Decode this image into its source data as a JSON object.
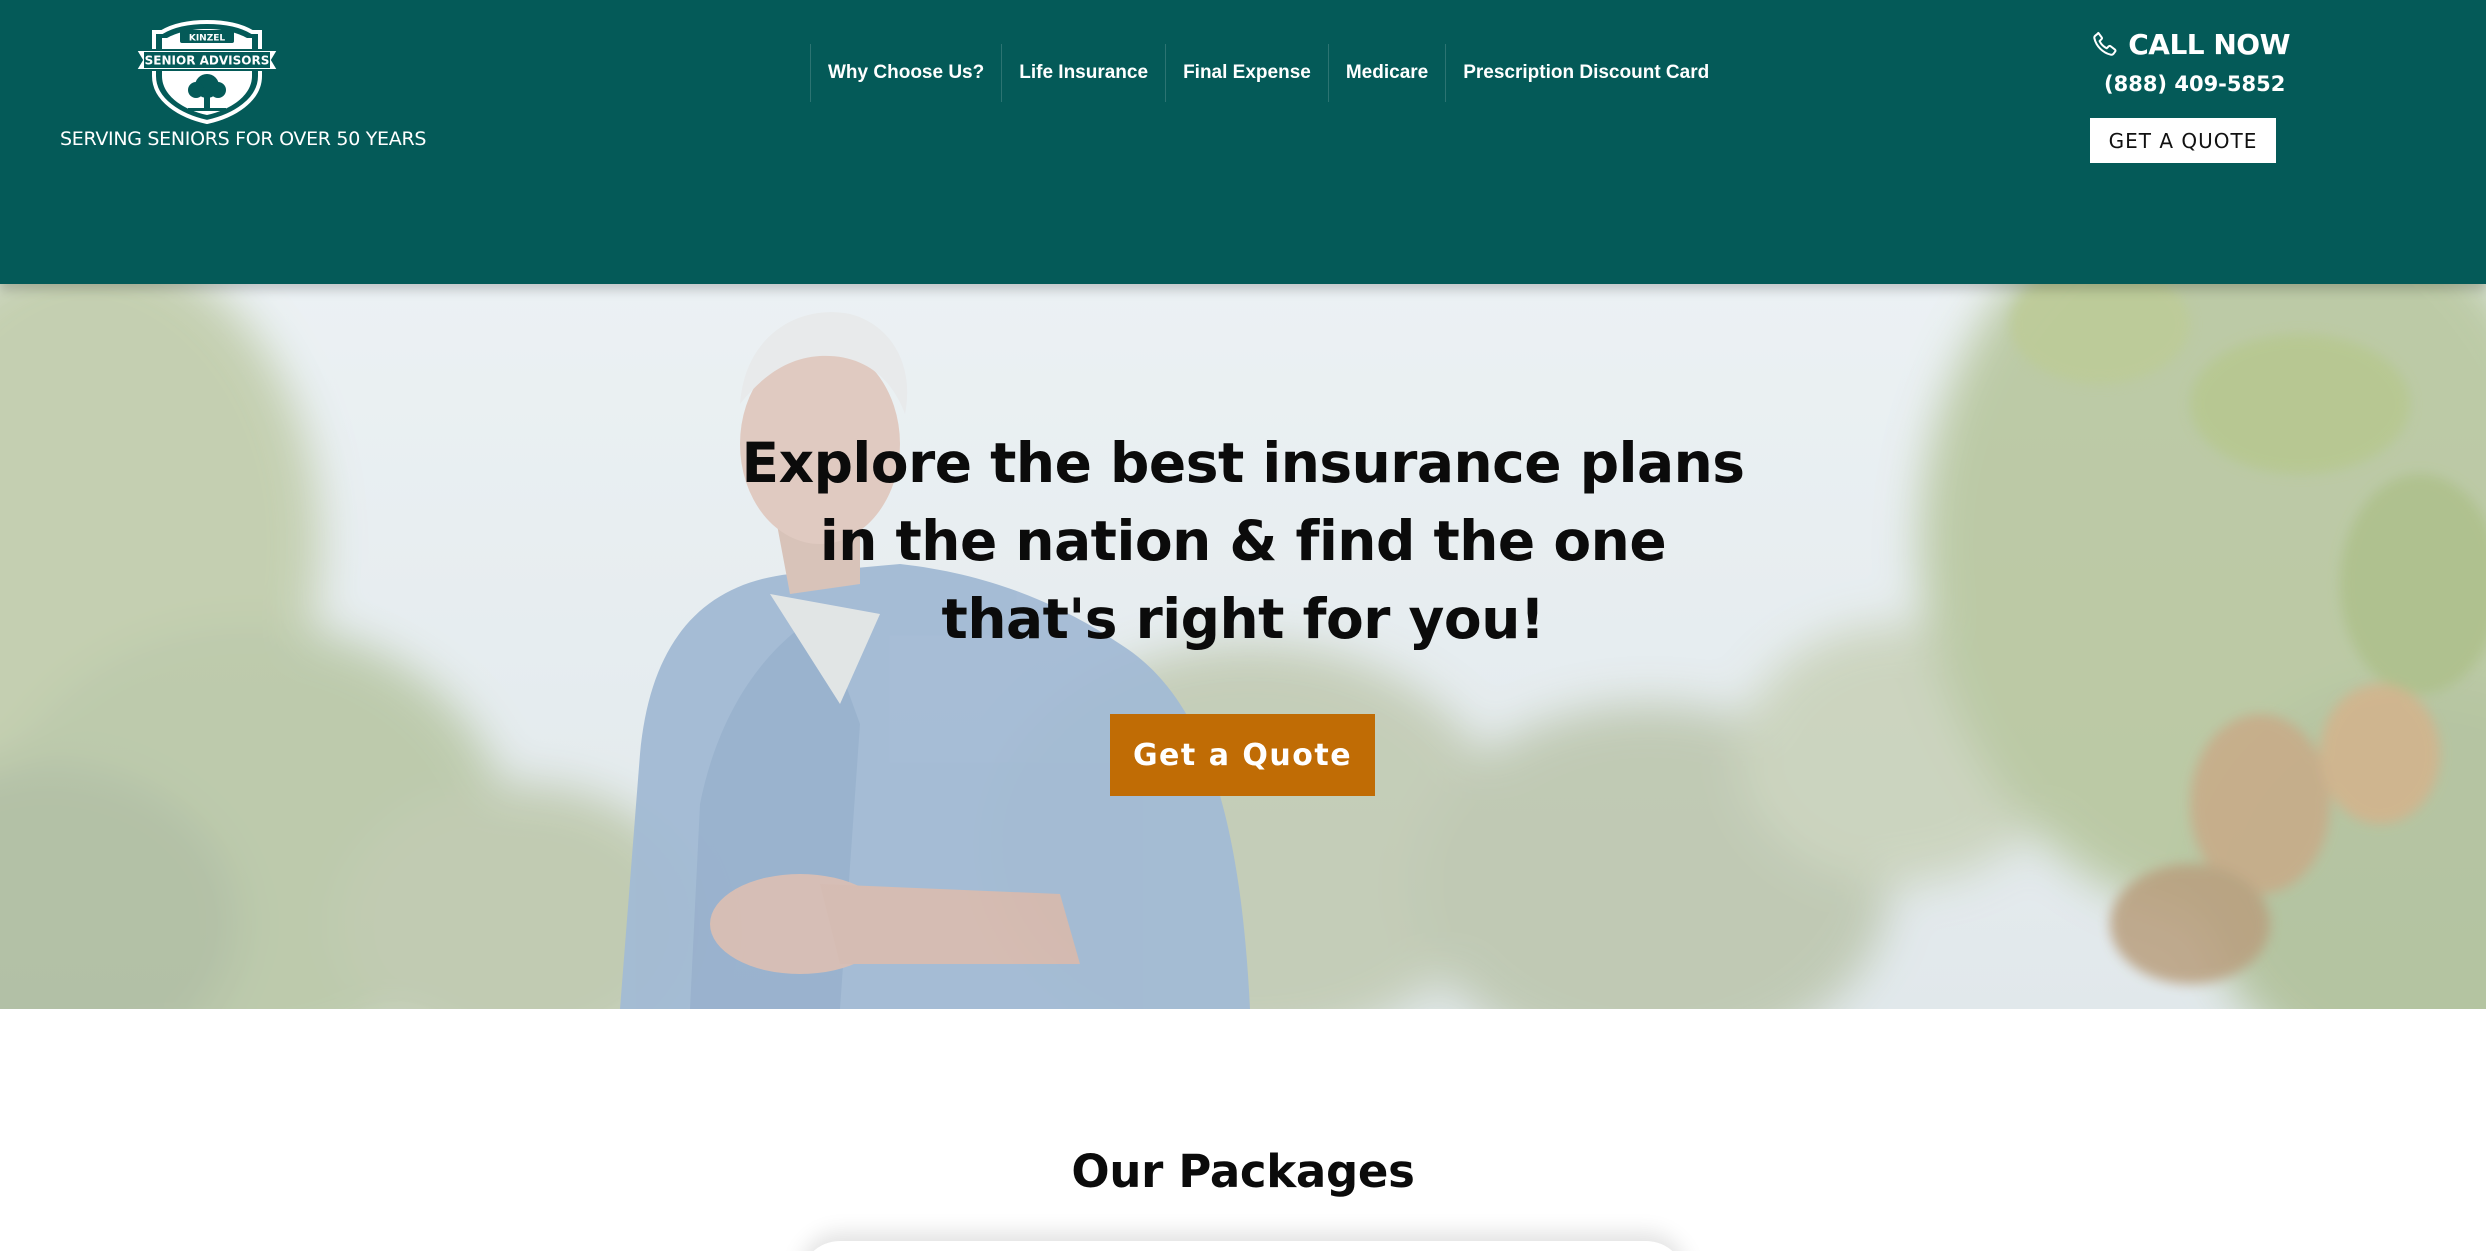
{
  "header": {
    "logo": {
      "badge_top": "KINZEL",
      "badge_main": "SENIOR ADVISORS",
      "tagline": "SERVING SENIORS FOR OVER 50 YEARS"
    },
    "nav": [
      {
        "label": "Why Choose Us?"
      },
      {
        "label": "Life Insurance"
      },
      {
        "label": "Final Expense"
      },
      {
        "label": "Medicare"
      },
      {
        "label": "Prescription Discount Card"
      }
    ],
    "call": {
      "label": "CALL NOW",
      "number": "(888) 409-5852",
      "icon": "phone-icon"
    },
    "quote_button": "GET A QUOTE"
  },
  "hero": {
    "heading_lines": [
      "Explore the best insurance plans",
      "in the nation & find the one",
      "that's right for you!"
    ],
    "cta": "Get a Quote"
  },
  "packages": {
    "title": "Our Packages"
  },
  "colors": {
    "header_bg": "#045a58",
    "cta_bg": "#c06c05",
    "text_dark": "#0b0b0b",
    "white": "#ffffff"
  }
}
